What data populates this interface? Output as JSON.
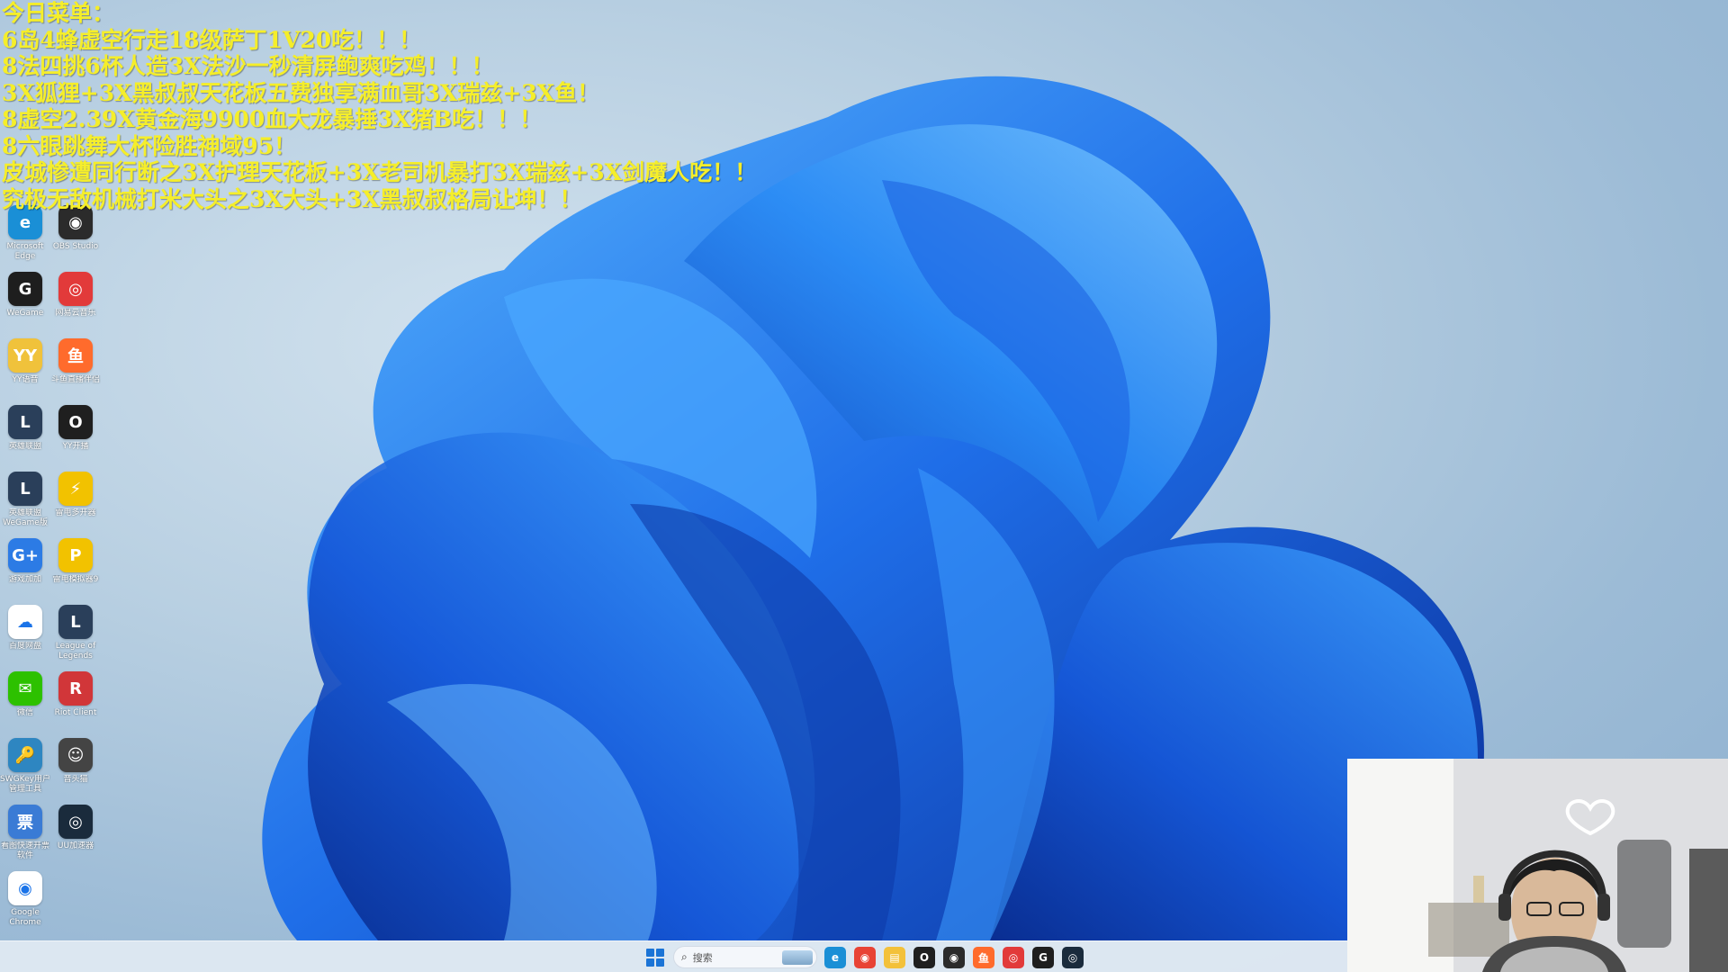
{
  "overlay_text": {
    "lines": [
      "今日菜单：",
      "6岛4蜂虚空行走18级萨丁1V20吃！！！",
      "8法四挑6杯人造3X法沙一秒清屏鲍爽吃鸡！！！",
      "3X狐狸+3X黑叔叔天花板五费独享满血哥3X瑞兹+3X鱼！",
      "8虚空2.39X黄金海9900血大龙暴捶3X猪B吃！！！",
      "8六眼跳舞大杯险胜神域95！",
      "皮城惨遭同行断之3X护理天花板+3X老司机暴打3X瑞兹+3X剑魔人吃！！",
      "究极无敌机械打米大头之3X大头+3X黑叔叔格局让坤！！"
    ],
    "color": "#f5ee2a"
  },
  "desktop_icons": [
    {
      "label": "Microsoft Edge",
      "icon": "edge-icon",
      "color": "#1a8fd6",
      "glyph": "e"
    },
    {
      "label": "OBS Studio",
      "icon": "obs-icon",
      "color": "#2b2b2b",
      "glyph": "◉"
    },
    {
      "label": "WeGame",
      "icon": "wegame-icon",
      "color": "#1e1e1e",
      "glyph": "G"
    },
    {
      "label": "网易云音乐",
      "icon": "netease-music-icon",
      "color": "#e23a3a",
      "glyph": "◎"
    },
    {
      "label": "YY语音",
      "icon": "yy-voice-icon",
      "color": "#f0c23b",
      "glyph": "YY"
    },
    {
      "label": "斗鱼直播伴侣",
      "icon": "douyu-icon",
      "color": "#ff6b2c",
      "glyph": "鱼"
    },
    {
      "label": "英雄联盟",
      "icon": "lol-icon",
      "color": "#2a3f5a",
      "glyph": "L"
    },
    {
      "label": "YY开播",
      "icon": "yy-live-icon",
      "color": "#1f1f1f",
      "glyph": "O"
    },
    {
      "label": "英雄联盟WeGame版",
      "icon": "lol-wegame-icon",
      "color": "#2a3f5a",
      "glyph": "L"
    },
    {
      "label": "雷电多开器",
      "icon": "ldplayer-multi-icon",
      "color": "#f2c200",
      "glyph": "⚡"
    },
    {
      "label": "游戏加加",
      "icon": "gameplus-icon",
      "color": "#2c7be5",
      "glyph": "G+"
    },
    {
      "label": "雷电模拟器9",
      "icon": "ldplayer-icon",
      "color": "#f2c200",
      "glyph": "P"
    },
    {
      "label": "百度网盘",
      "icon": "baidu-netdisk-icon",
      "color": "#ffffff",
      "glyph": "☁"
    },
    {
      "label": "League of Legends",
      "icon": "league-icon",
      "color": "#2a3f5a",
      "glyph": "L"
    },
    {
      "label": "微信",
      "icon": "wechat-icon",
      "color": "#2dc100",
      "glyph": "✉"
    },
    {
      "label": "Riot Client",
      "icon": "riot-client-icon",
      "color": "#d13639",
      "glyph": "R"
    },
    {
      "label": "SWGKey用户管理工具",
      "icon": "key-tool-icon",
      "color": "#2e86c1",
      "glyph": "🔑"
    },
    {
      "label": "音头猫",
      "icon": "audio-cat-icon",
      "color": "#444444",
      "glyph": "☺"
    },
    {
      "label": "看图快速开票软件",
      "icon": "invoice-tool-icon",
      "color": "#3a7bd5",
      "glyph": "票"
    },
    {
      "label": "UU加速器",
      "icon": "uu-accelerator-icon",
      "color": "#1a2b3c",
      "glyph": "◎"
    },
    {
      "label": "Google Chrome",
      "icon": "chrome-icon",
      "color": "#ffffff",
      "glyph": "◉"
    }
  ],
  "taskbar": {
    "search_placeholder": "搜索",
    "pinned_apps": [
      {
        "name": "edge-icon",
        "color": "#1a8fd6",
        "glyph": "e"
      },
      {
        "name": "chrome-icon",
        "color": "#e84335",
        "glyph": "◉"
      },
      {
        "name": "file-explorer-icon",
        "color": "#f3c13a",
        "glyph": "▤"
      },
      {
        "name": "yy-live-icon",
        "color": "#1f1f1f",
        "glyph": "O"
      },
      {
        "name": "obs-icon",
        "color": "#2b2b2b",
        "glyph": "◉"
      },
      {
        "name": "douyu-icon",
        "color": "#ff6b2c",
        "glyph": "鱼"
      },
      {
        "name": "netease-music-icon",
        "color": "#e23a3a",
        "glyph": "◎"
      },
      {
        "name": "wegame-icon",
        "color": "#1e1e1e",
        "glyph": "G"
      },
      {
        "name": "uu-accelerator-icon",
        "color": "#1a2b3c",
        "glyph": "◎"
      }
    ]
  },
  "colors": {
    "accent": "#1b74d6",
    "taskbar": "#e2eaf3"
  }
}
